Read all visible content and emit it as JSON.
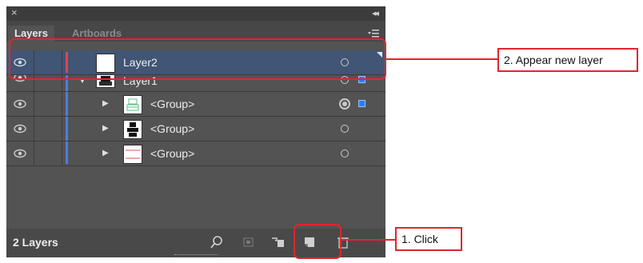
{
  "panel": {
    "close_glyph": "×",
    "collapse_glyph": "◂◂",
    "tabs": [
      {
        "label": "Layers"
      },
      {
        "label": "Artboards"
      }
    ]
  },
  "layers": [
    {
      "label": "Layer2",
      "selected": true,
      "color": "#e0444e"
    },
    {
      "label": "Layer1",
      "selected": false,
      "color": "#4f7be3"
    },
    {
      "label": "<Group>",
      "selected": false,
      "color": "#4f7be3"
    },
    {
      "label": "<Group>",
      "selected": false,
      "color": "#4f7be3"
    },
    {
      "label": "<Group>",
      "selected": false,
      "color": "#4f7be3"
    }
  ],
  "status": {
    "count_text": "2 Layers"
  },
  "callouts": {
    "appear": "2. Appear new layer",
    "click": "1. Click"
  },
  "colors": {
    "annotation_red": "#e0262d",
    "selection_row": "#415575",
    "selection_square": "#2f7cf6"
  }
}
